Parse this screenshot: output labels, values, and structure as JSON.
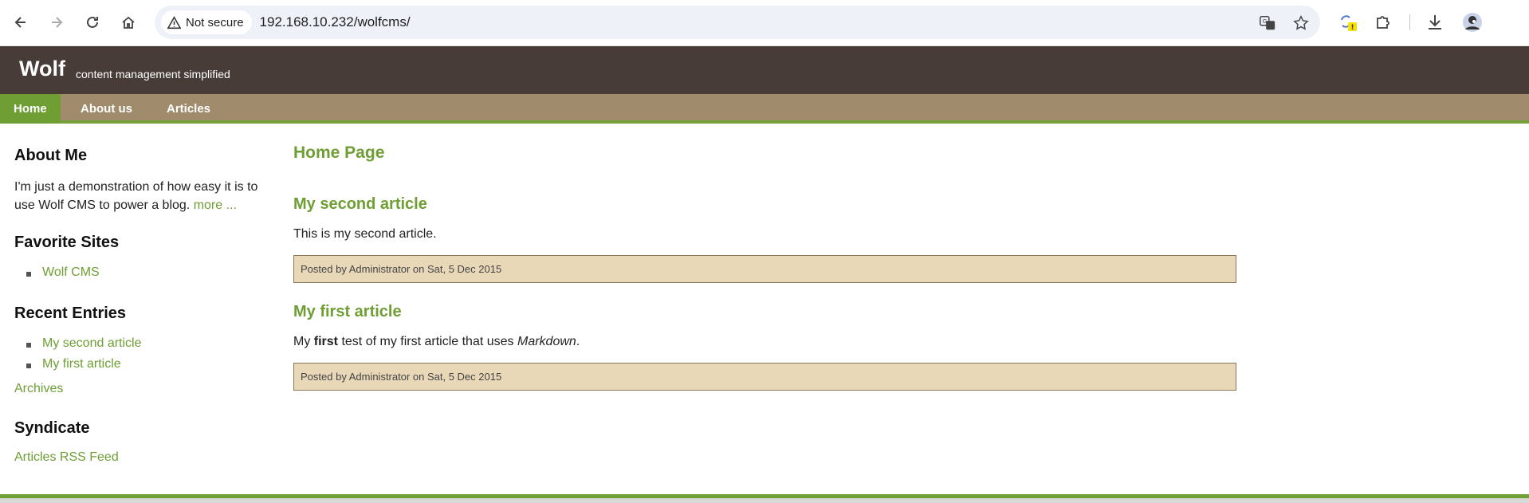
{
  "browser": {
    "security_label": "Not secure",
    "url": "192.168.10.232/wolfcms/"
  },
  "site": {
    "logo": "Wolf",
    "tagline": "content management simplified",
    "nav": [
      {
        "label": "Home",
        "active": true
      },
      {
        "label": "About us",
        "active": false
      },
      {
        "label": "Articles",
        "active": false
      }
    ]
  },
  "sidebar": {
    "about_heading": "About Me",
    "about_text": "I'm just a demonstration of how easy it is to use Wolf CMS to power a blog.",
    "about_more": "more ...",
    "favorites_heading": "Favorite Sites",
    "favorites": [
      "Wolf CMS"
    ],
    "recent_heading": "Recent Entries",
    "recent": [
      "My second article",
      "My first article"
    ],
    "archives": "Archives",
    "syndicate_heading": "Syndicate",
    "rss": "Articles RSS Feed"
  },
  "main": {
    "page_title": "Home Page",
    "articles": [
      {
        "title": "My second article",
        "body": "This is my second article.",
        "meta": "Posted by Administrator on Sat, 5 Dec 2015"
      },
      {
        "title": "My first article",
        "body_prefix": "My ",
        "body_bold": "first",
        "body_mid": " test of my first article that uses ",
        "body_em": "Markdown",
        "body_suffix": ".",
        "meta": "Posted by Administrator on Sat, 5 Dec 2015"
      }
    ]
  },
  "colors": {
    "header_bg": "#483c39",
    "nav_bg": "#a08c6c",
    "accent": "#6e9e34",
    "meta_bg": "#e9d8b8"
  }
}
